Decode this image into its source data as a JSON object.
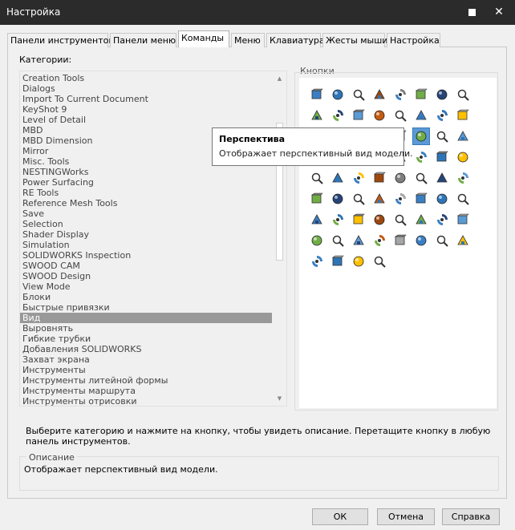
{
  "window": {
    "title": "Настройка",
    "maximize_label": "",
    "close_label": "✕"
  },
  "tabs": [
    {
      "label": "Панели инструментов"
    },
    {
      "label": "Панели меню"
    },
    {
      "label": "Команды",
      "active": true
    },
    {
      "label": "Меню"
    },
    {
      "label": "Клавиатура"
    },
    {
      "label": "Жесты мыши"
    },
    {
      "label": "Настройка"
    }
  ],
  "categories": {
    "label": "Категории:",
    "items": [
      "Creation Tools",
      "Dialogs",
      "Import To Current Document",
      "KeyShot 9",
      "Level of Detail",
      "MBD",
      "MBD Dimension",
      "Mirror",
      "Misc. Tools",
      "NESTINGWorks",
      "Power Surfacing",
      "RE Tools",
      "Reference Mesh Tools",
      "Save",
      "Selection",
      "Shader Display",
      "Simulation",
      "SOLIDWORKS Inspection",
      "SWOOD CAM",
      "SWOOD Design",
      "View Mode",
      "Блоки",
      "Быстрые привязки",
      "Вид",
      "Выровнять",
      "Гибкие трубки",
      "Добавления SOLIDWORKS",
      "Захват экрана",
      "Инструменты",
      "Инструменты литейной формы",
      "Инструменты маршрута",
      "Инструменты отрисовки"
    ],
    "selected": "Вид"
  },
  "buttons_panel": {
    "label": "Кнопки"
  },
  "tooltip": {
    "title": "Перспектива",
    "description": "Отображает перспективный вид модели."
  },
  "hint_text": "Выберите категорию и нажмите на кнопку, чтобы увидеть описание. Перетащите кнопку в любую панель инструментов.",
  "description": {
    "legend": "Описание",
    "text": "Отображает перспективный вид модели."
  },
  "footer": {
    "ok_label": "ОК",
    "cancel_label": "Отмена",
    "help_label": "Справка"
  },
  "colors": {
    "titlebar": "#2b2b2b",
    "selection": "#999999",
    "highlight_button": "#5a9ad6"
  }
}
